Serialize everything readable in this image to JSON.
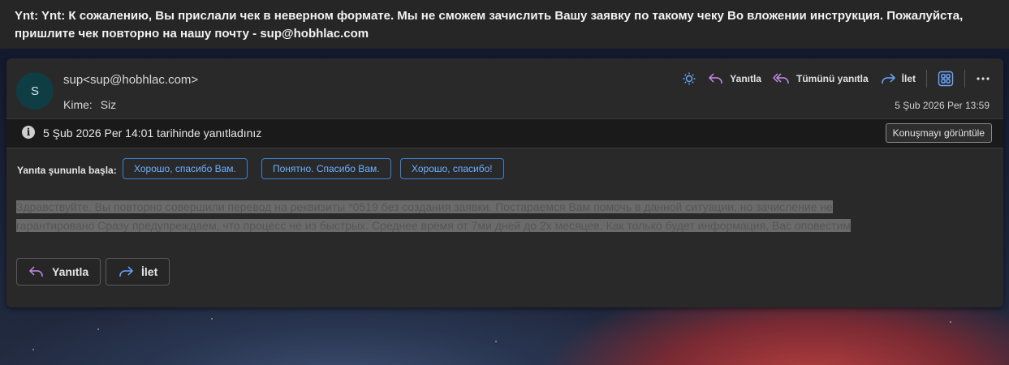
{
  "subject": "Ynt: Ynt: К сожалению, Вы прислали чек в неверном формате. Мы не сможем зачислить Вашу заявку по такому чеку Во вложении инструкция. Пожалуйста, пришлите чек повторно на нашу почту - sup@hobhlac.com",
  "sender": {
    "initial": "S",
    "display": "sup<sup@hobhlac.com>"
  },
  "recipients": {
    "label": "Kime:",
    "value": "Siz"
  },
  "date": "5 Şub 2026 Per 13:59",
  "toolbar": {
    "reply": "Yanıtla",
    "reply_all": "Tümünü yanıtla",
    "forward": "İlet",
    "icons": [
      "sun-icon",
      "reply-icon",
      "reply-all-icon",
      "forward-icon",
      "apps-icon",
      "more-icon"
    ]
  },
  "info_bar": {
    "text": "5 Şub 2026 Per 14:01 tarihinde yanıtladınız",
    "button": "Konuşmayı görüntüle"
  },
  "suggested_replies": {
    "label": "Yanıta şununla başla:",
    "options": [
      "Хорошо, спасибо Вам.",
      "Понятно. Спасибо Вам.",
      "Хорошо, спасибо!"
    ]
  },
  "body_lines": [
    "Здравствуйте. Вы повторно совершили перевод на реквизиты *0519 без создания заявки. Постараемся Вам помочь в данной ситуации, но зачисление не",
    "гарантировано Сразу предупреждаем, что процесс не из быстрых. Среднее время от 7ми дней до 2х месяцев. Как только будет информация, Вас оповестим"
  ],
  "footer": {
    "reply": "Yanıtla",
    "forward": "İlet"
  },
  "colors": {
    "accent": "#3b82d6",
    "reply_icon": "#c78be8",
    "forward_icon": "#6aa7ff"
  }
}
